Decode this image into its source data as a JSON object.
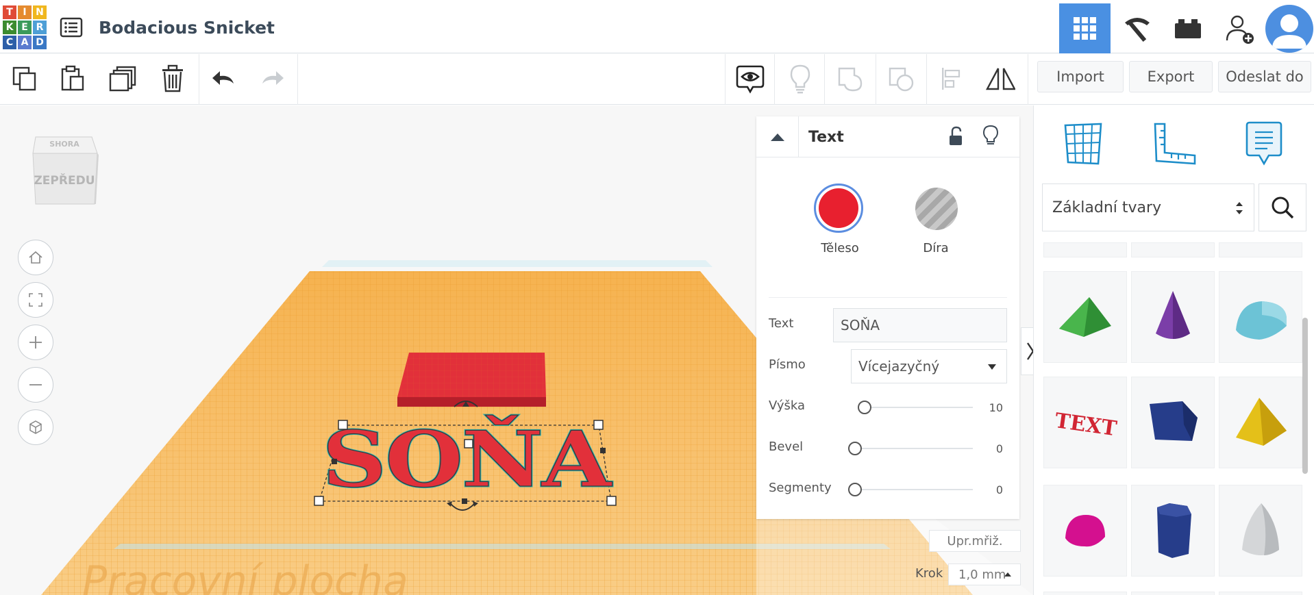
{
  "app": {
    "logo_letters": [
      "T",
      "I",
      "N",
      "K",
      "E",
      "R",
      "C",
      "A",
      "D"
    ],
    "logo_colors": [
      "#e04b37",
      "#e58b2f",
      "#f0b71f",
      "#3c8b2f",
      "#3b9a5b",
      "#4e9fd6",
      "#2d5fa8",
      "#5b7bcf",
      "#3a78c5"
    ],
    "project_title": "Bodacious Snicket"
  },
  "header_icons": [
    "grid-icon",
    "pickaxe-icon",
    "bricks-icon",
    "add-user-icon",
    "user-avatar"
  ],
  "toolbar": {
    "buttons": [
      "copy-icon",
      "paste-icon",
      "duplicate-icon",
      "delete-icon",
      "undo-icon",
      "redo-icon"
    ],
    "right_buttons": [
      "notes-eye-icon",
      "lightbulb-icon",
      "group-icon",
      "ungroup-icon",
      "align-icon",
      "mirror-icon"
    ],
    "import_label": "Import",
    "export_label": "Export",
    "send_label": "Odeslat do"
  },
  "viewcube": {
    "top_label": "SHORA",
    "front_label": "ZEPŘEDU"
  },
  "workplane": {
    "label": "Pracovní plocha",
    "text_object": "SOŇA",
    "accent": "#f2a93b"
  },
  "inspector": {
    "title": "Text",
    "solid_label": "Těleso",
    "hole_label": "Díra",
    "solid_color": "#e8202f",
    "text_label": "Text",
    "text_value": "SOŇA",
    "font_label": "Písmo",
    "font_value": "Vícejazyčný",
    "height_label": "Výška",
    "height_value": "10",
    "bevel_label": "Bevel",
    "bevel_value": "0",
    "segments_label": "Segmenty",
    "segments_value": "0"
  },
  "grid": {
    "edit_grid_label": "Upr.mřiž.",
    "step_label": "Krok",
    "step_value": "1,0 mm"
  },
  "shapes_panel": {
    "library_select": "Základní tvary",
    "shapes": [
      "wedge-green",
      "cone-purple",
      "half-cylinder-teal",
      "text-red",
      "polygon-navy",
      "pyramid-yellow",
      "half-sphere-magenta",
      "hexagonal-prism-navy",
      "paraboloid-gray"
    ]
  }
}
